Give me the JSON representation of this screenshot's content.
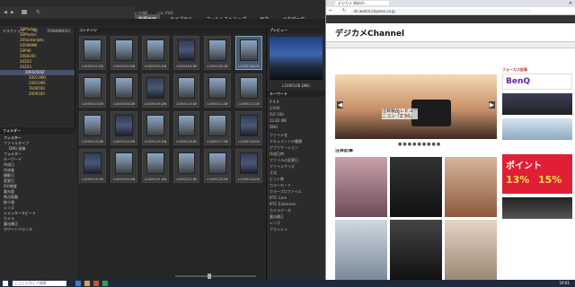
{
  "photo_app": {
    "menu": [
      "ファイル(F)",
      "編集(E)",
      "表示(V)",
      "ラベル(L)",
      "ツール(T)",
      "ウィンドウ(W)",
      "ヘルプ(H)"
    ],
    "tabs": [
      {
        "label": "新規画面",
        "active": true
      },
      {
        "label": "ライブラリ",
        "active": false
      },
      {
        "label": "フィルムストリップ",
        "active": false
      },
      {
        "label": "出力",
        "active": false
      },
      {
        "label": "メタデータ",
        "active": false
      }
    ],
    "path": [
      "デスクトップ",
      "PC",
      "YOSHIAKI(D:)",
      "20Photos",
      "20Z43",
      "2001050LT...",
      "Z50.."
    ],
    "content_title": "コンテンツ",
    "preview_title": "プレビュー",
    "keyword_title": "キーワード",
    "folder_tab": "フォルダー",
    "folders": [
      "20Photos",
      "20Photos",
      "20StoHanJets",
      "2009MMII",
      "20P46",
      "2008300",
      "20Z03",
      "20Z43",
      "2001050LT",
      "20013MO",
      "20012MS",
      "TAOKT0R",
      "2009300"
    ],
    "filter_items": [
      "フィルター",
      "ファイルタイプ",
      "DNG 画像",
      "フォルダー",
      "キーワード",
      "作成日",
      "作成者",
      "撮影日",
      "変更日",
      "ISO感度",
      "露光量",
      "焦点距離",
      "絞り値",
      "レンズ",
      "シャッタースピード",
      "カメラ",
      "露出補正",
      "ホワイトバランス"
    ],
    "thumbnails": [
      "L1005101.DNG",
      "L1005102.DNG",
      "L1005103.DNG",
      "L1005104.DNG",
      "L1005105.DNG",
      "L1005106.DNG",
      "L1005107.DNG",
      "L1005108.DNG",
      "L1005109.DNG",
      "L1005110.DNG",
      "L1005111.DNG",
      "L1005112.DNG",
      "L1005113.DNG",
      "L1005114.DNG",
      "L1005115.DNG",
      "L1005116.DNG",
      "L1005117.DNG",
      "L1005118.DNG",
      "L1005119.DNG",
      "L1005120.DNG",
      "L1005121.DNG",
      "L1005122.DNG",
      "L1005123.DNG",
      "L1005124.DNG"
    ],
    "preview_caption": "L1005106.DNG",
    "exif": [
      "f/ 4.0",
      "1/200",
      "ISO 100",
      "23.82 MB",
      "DNG"
    ],
    "metadata_rows": [
      "ファイル名",
      "ドキュメントの種類",
      "アプリケーション",
      "作成日時",
      "ファイルの変更日",
      "ファイルサイズ",
      "寸法",
      "ビット数",
      "カラーモード",
      "カラープロファイル",
      "IPTC Core",
      "IPTC Extension",
      "カメラデータ",
      "露出補正",
      "レンズ",
      "フラッシュ"
    ]
  },
  "browser": {
    "tab": "デジカメ Watch",
    "url": "dc.watch.impress.co.jp",
    "site": "デジカメChannel",
    "slide_caption": "注目製品レビュー ニコン「Z 50」",
    "section": "注目記事",
    "brand": "BenQ",
    "ad_point": "ポイント",
    "ad_pct": "13%",
    "ad_pct2": "15%",
    "side_label": "フォーカス記事"
  },
  "taskbar": {
    "time": "19:01",
    "search": "ここに入力して検索"
  }
}
